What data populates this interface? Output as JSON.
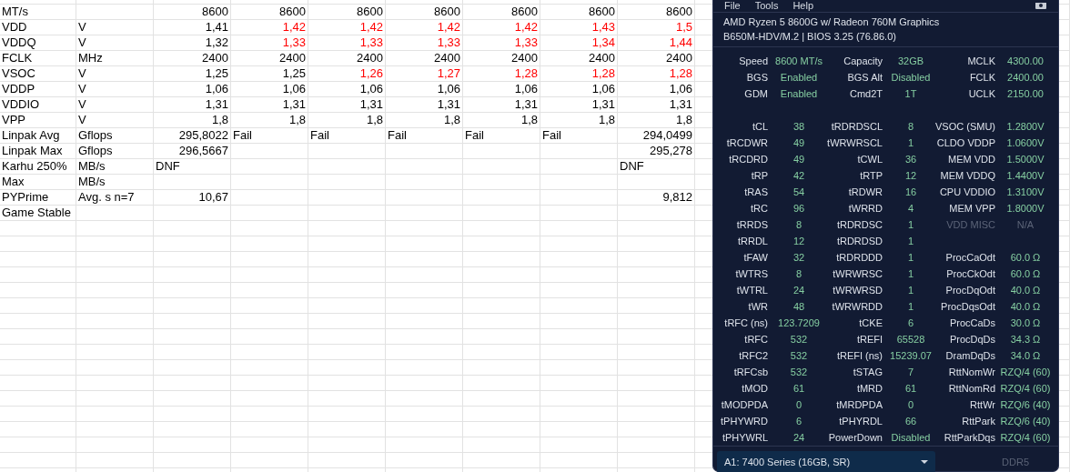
{
  "spreadsheet": {
    "rows": [
      {
        "label": "MT/s",
        "values": [
          {
            "text": "8600",
            "kind": "number",
            "color": "#000000"
          },
          {
            "text": "8600",
            "kind": "number",
            "color": "#000000"
          },
          {
            "text": "8600",
            "kind": "number",
            "color": "#000000"
          },
          {
            "text": "8600",
            "kind": "number",
            "color": "#000000"
          },
          {
            "text": "8600",
            "kind": "number",
            "color": "#000000"
          },
          {
            "text": "8600",
            "kind": "number",
            "color": "#000000"
          },
          {
            "text": "8600",
            "kind": "number",
            "color": "#000000"
          }
        ]
      },
      {
        "label": "VDD",
        "unit": "V",
        "values": [
          {
            "text": "1,41",
            "kind": "number",
            "color": "#000000"
          },
          {
            "text": "1,42",
            "kind": "number",
            "color": "#ff0000"
          },
          {
            "text": "1,42",
            "kind": "number",
            "color": "#ff0000"
          },
          {
            "text": "1,42",
            "kind": "number",
            "color": "#ff0000"
          },
          {
            "text": "1,42",
            "kind": "number",
            "color": "#ff0000"
          },
          {
            "text": "1,43",
            "kind": "number",
            "color": "#ff0000"
          },
          {
            "text": "1,5",
            "kind": "number",
            "color": "#ff0000"
          }
        ]
      },
      {
        "label": "VDDQ",
        "unit": "V",
        "values": [
          {
            "text": "1,32",
            "kind": "number",
            "color": "#000000"
          },
          {
            "text": "1,33",
            "kind": "number",
            "color": "#ff0000"
          },
          {
            "text": "1,33",
            "kind": "number",
            "color": "#ff0000"
          },
          {
            "text": "1,33",
            "kind": "number",
            "color": "#ff0000"
          },
          {
            "text": "1,33",
            "kind": "number",
            "color": "#ff0000"
          },
          {
            "text": "1,34",
            "kind": "number",
            "color": "#ff0000"
          },
          {
            "text": "1,44",
            "kind": "number",
            "color": "#ff0000"
          }
        ]
      },
      {
        "label": "FCLK",
        "unit": "MHz",
        "values": [
          {
            "text": "2400",
            "kind": "number",
            "color": "#000000"
          },
          {
            "text": "2400",
            "kind": "number",
            "color": "#000000"
          },
          {
            "text": "2400",
            "kind": "number",
            "color": "#000000"
          },
          {
            "text": "2400",
            "kind": "number",
            "color": "#000000"
          },
          {
            "text": "2400",
            "kind": "number",
            "color": "#000000"
          },
          {
            "text": "2400",
            "kind": "number",
            "color": "#000000"
          },
          {
            "text": "2400",
            "kind": "number",
            "color": "#000000"
          }
        ]
      },
      {
        "label": "VSOC",
        "unit": "V",
        "values": [
          {
            "text": "1,25",
            "kind": "number",
            "color": "#000000"
          },
          {
            "text": "1,25",
            "kind": "number",
            "color": "#000000"
          },
          {
            "text": "1,26",
            "kind": "number",
            "color": "#ff0000"
          },
          {
            "text": "1,27",
            "kind": "number",
            "color": "#ff0000"
          },
          {
            "text": "1,28",
            "kind": "number",
            "color": "#ff0000"
          },
          {
            "text": "1,28",
            "kind": "number",
            "color": "#ff0000"
          },
          {
            "text": "1,28",
            "kind": "number",
            "color": "#ff0000"
          }
        ]
      },
      {
        "label": "VDDP",
        "unit": "V",
        "values": [
          {
            "text": "1,06",
            "kind": "number",
            "color": "#000000"
          },
          {
            "text": "1,06",
            "kind": "number",
            "color": "#000000"
          },
          {
            "text": "1,06",
            "kind": "number",
            "color": "#000000"
          },
          {
            "text": "1,06",
            "kind": "number",
            "color": "#000000"
          },
          {
            "text": "1,06",
            "kind": "number",
            "color": "#000000"
          },
          {
            "text": "1,06",
            "kind": "number",
            "color": "#000000"
          },
          {
            "text": "1,06",
            "kind": "number",
            "color": "#000000"
          }
        ]
      },
      {
        "label": "VDDIO",
        "unit": "V",
        "values": [
          {
            "text": "1,31",
            "kind": "number",
            "color": "#000000"
          },
          {
            "text": "1,31",
            "kind": "number",
            "color": "#000000"
          },
          {
            "text": "1,31",
            "kind": "number",
            "color": "#000000"
          },
          {
            "text": "1,31",
            "kind": "number",
            "color": "#000000"
          },
          {
            "text": "1,31",
            "kind": "number",
            "color": "#000000"
          },
          {
            "text": "1,31",
            "kind": "number",
            "color": "#000000"
          },
          {
            "text": "1,31",
            "kind": "number",
            "color": "#000000"
          }
        ]
      },
      {
        "label": "VPP",
        "unit": "V",
        "values": [
          {
            "text": "1,8",
            "kind": "number",
            "color": "#000000"
          },
          {
            "text": "1,8",
            "kind": "number",
            "color": "#000000"
          },
          {
            "text": "1,8",
            "kind": "number",
            "color": "#000000"
          },
          {
            "text": "1,8",
            "kind": "number",
            "color": "#000000"
          },
          {
            "text": "1,8",
            "kind": "number",
            "color": "#000000"
          },
          {
            "text": "1,8",
            "kind": "number",
            "color": "#000000"
          },
          {
            "text": "1,8",
            "kind": "number",
            "color": "#000000"
          }
        ]
      },
      {
        "label": "Linpak Avg",
        "unit": "Gflops",
        "values": [
          {
            "text": "295,8022",
            "kind": "number",
            "color": "#000000"
          },
          {
            "text": "Fail",
            "kind": "text",
            "color": "#000000"
          },
          {
            "text": "Fail",
            "kind": "text",
            "color": "#000000"
          },
          {
            "text": "Fail",
            "kind": "text",
            "color": "#000000"
          },
          {
            "text": "Fail",
            "kind": "text",
            "color": "#000000"
          },
          {
            "text": "Fail",
            "kind": "text",
            "color": "#000000"
          },
          {
            "text": "294,0499",
            "kind": "number",
            "color": "#000000"
          }
        ]
      },
      {
        "label": "Linpak Max",
        "unit": "Gflops",
        "values": [
          {
            "text": "296,5667",
            "kind": "number",
            "color": "#000000"
          },
          {
            "kind": "empty"
          },
          {
            "kind": "empty"
          },
          {
            "kind": "empty"
          },
          {
            "kind": "empty"
          },
          {
            "kind": "empty"
          },
          {
            "text": "295,278",
            "kind": "number",
            "color": "#000000"
          }
        ]
      },
      {
        "label": "Karhu 250%",
        "unit": "MB/s",
        "values": [
          {
            "text": "DNF",
            "kind": "text",
            "color": "#000000"
          },
          {
            "kind": "empty"
          },
          {
            "kind": "empty"
          },
          {
            "kind": "empty"
          },
          {
            "kind": "empty"
          },
          {
            "kind": "empty"
          },
          {
            "text": "DNF",
            "kind": "text",
            "color": "#000000"
          }
        ]
      },
      {
        "label": "Max",
        "unit": "MB/s"
      },
      {
        "label": "PYPrime",
        "unit": "Avg. s n=7",
        "values": [
          {
            "text": "10,67",
            "kind": "number",
            "color": "#000000"
          },
          {
            "kind": "empty"
          },
          {
            "kind": "empty"
          },
          {
            "kind": "empty"
          },
          {
            "kind": "empty"
          },
          {
            "kind": "empty"
          },
          {
            "text": "9,812",
            "kind": "number",
            "color": "#000000"
          }
        ]
      },
      {
        "label": "Game Stable"
      }
    ]
  },
  "timings_window": {
    "menu": [
      "File",
      "Tools",
      "Help"
    ],
    "cpu": "AMD Ryzen 5 8600G w/ Radeon 760M Graphics",
    "board": "B650M-HDV/M.2 | BIOS 3.25 (76.86.0)",
    "summary": [
      [
        {
          "label": "Speed",
          "value": "8600 MT/s",
          "disabled": false
        },
        {
          "label": "Capacity",
          "value": "32GB",
          "disabled": false
        },
        {
          "label": "MCLK",
          "value": "4300.00",
          "disabled": false
        }
      ],
      [
        {
          "label": "BGS",
          "value": "Enabled",
          "disabled": false
        },
        {
          "label": "BGS Alt",
          "value": "Disabled",
          "disabled": false
        },
        {
          "label": "FCLK",
          "value": "2400.00",
          "disabled": false
        }
      ],
      [
        {
          "label": "GDM",
          "value": "Enabled",
          "disabled": false
        },
        {
          "label": "Cmd2T",
          "value": "1T",
          "disabled": false
        },
        {
          "label": "UCLK",
          "value": "2150.00",
          "disabled": false
        }
      ]
    ],
    "timings": [
      [
        {
          "label": "tCL",
          "value": "38",
          "disabled": false
        },
        {
          "label": "tRDRDSCL",
          "value": "8",
          "disabled": false
        },
        {
          "label": "VSOC (SMU)",
          "value": "1.2800V",
          "disabled": false
        }
      ],
      [
        {
          "label": "tRCDWR",
          "value": "49",
          "disabled": false
        },
        {
          "label": "tWRWRSCL",
          "value": "1",
          "disabled": false
        },
        {
          "label": "CLDO VDDP",
          "value": "1.0600V",
          "disabled": false
        }
      ],
      [
        {
          "label": "tRCDRD",
          "value": "49",
          "disabled": false
        },
        {
          "label": "tCWL",
          "value": "36",
          "disabled": false
        },
        {
          "label": "MEM VDD",
          "value": "1.5000V",
          "disabled": false
        }
      ],
      [
        {
          "label": "tRP",
          "value": "42",
          "disabled": false
        },
        {
          "label": "tRTP",
          "value": "12",
          "disabled": false
        },
        {
          "label": "MEM VDDQ",
          "value": "1.4400V",
          "disabled": false
        }
      ],
      [
        {
          "label": "tRAS",
          "value": "54",
          "disabled": false
        },
        {
          "label": "tRDWR",
          "value": "16",
          "disabled": false
        },
        {
          "label": "CPU VDDIO",
          "value": "1.3100V",
          "disabled": false
        }
      ],
      [
        {
          "label": "tRC",
          "value": "96",
          "disabled": false
        },
        {
          "label": "tWRRD",
          "value": "4",
          "disabled": false
        },
        {
          "label": "MEM VPP",
          "value": "1.8000V",
          "disabled": false
        }
      ],
      [
        {
          "label": "tRRDS",
          "value": "8",
          "disabled": false
        },
        {
          "label": "tRDRDSC",
          "value": "1",
          "disabled": false
        },
        {
          "label": "VDD MISC",
          "value": "N/A",
          "disabled": true
        }
      ],
      [
        {
          "label": "tRRDL",
          "value": "12",
          "disabled": false
        },
        {
          "label": "tRDRDSD",
          "value": "1",
          "disabled": false
        }
      ],
      [
        {
          "label": "tFAW",
          "value": "32",
          "disabled": false
        },
        {
          "label": "tRDRDDD",
          "value": "1",
          "disabled": false
        },
        {
          "label": "ProcCaOdt",
          "value": "60.0 Ω",
          "disabled": false
        }
      ],
      [
        {
          "label": "tWTRS",
          "value": "8",
          "disabled": false
        },
        {
          "label": "tWRWRSC",
          "value": "1",
          "disabled": false
        },
        {
          "label": "ProcCkOdt",
          "value": "60.0 Ω",
          "disabled": false
        }
      ],
      [
        {
          "label": "tWTRL",
          "value": "24",
          "disabled": false
        },
        {
          "label": "tWRWRSD",
          "value": "1",
          "disabled": false
        },
        {
          "label": "ProcDqOdt",
          "value": "40.0 Ω",
          "disabled": false
        }
      ],
      [
        {
          "label": "tWR",
          "value": "48",
          "disabled": false
        },
        {
          "label": "tWRWRDD",
          "value": "1",
          "disabled": false
        },
        {
          "label": "ProcDqsOdt",
          "value": "40.0 Ω",
          "disabled": false
        }
      ],
      [
        {
          "label": "tRFC (ns)",
          "value": "123.7209",
          "disabled": false
        },
        {
          "label": "tCKE",
          "value": "6",
          "disabled": false
        },
        {
          "label": "ProcCaDs",
          "value": "30.0 Ω",
          "disabled": false
        }
      ],
      [
        {
          "label": "tRFC",
          "value": "532",
          "disabled": false
        },
        {
          "label": "tREFI",
          "value": "65528",
          "disabled": false
        },
        {
          "label": "ProcDqDs",
          "value": "34.3 Ω",
          "disabled": false
        }
      ],
      [
        {
          "label": "tRFC2",
          "value": "532",
          "disabled": false
        },
        {
          "label": "tREFI (ns)",
          "value": "15239.07",
          "disabled": false
        },
        {
          "label": "DramDqDs",
          "value": "34.0 Ω",
          "disabled": false
        }
      ],
      [
        {
          "label": "tRFCsb",
          "value": "532",
          "disabled": false
        },
        {
          "label": "tSTAG",
          "value": "7",
          "disabled": false
        },
        {
          "label": "RttNomWr",
          "value": "RZQ/4 (60)",
          "disabled": false
        }
      ],
      [
        {
          "label": "tMOD",
          "value": "61",
          "disabled": false
        },
        {
          "label": "tMRD",
          "value": "61",
          "disabled": false
        },
        {
          "label": "RttNomRd",
          "value": "RZQ/4 (60)",
          "disabled": false
        }
      ],
      [
        {
          "label": "tMODPDA",
          "value": "0",
          "disabled": false
        },
        {
          "label": "tMRDPDA",
          "value": "0",
          "disabled": false
        },
        {
          "label": "RttWr",
          "value": "RZQ/6 (40)",
          "disabled": false
        }
      ],
      [
        {
          "label": "tPHYWRD",
          "value": "6",
          "disabled": false
        },
        {
          "label": "tPHYRDL",
          "value": "66",
          "disabled": false
        },
        {
          "label": "RttPark",
          "value": "RZQ/6 (40)",
          "disabled": false
        }
      ],
      [
        {
          "label": "tPHYWRL",
          "value": "24",
          "disabled": false
        },
        {
          "label": "PowerDown",
          "value": "Disabled",
          "disabled": false
        },
        {
          "label": "RttParkDqs",
          "value": "RZQ/4 (60)",
          "disabled": false
        }
      ]
    ],
    "module_select": {
      "value": "A1: 7400 Series (16GB, SR)"
    },
    "memory_type": "DDR5"
  }
}
